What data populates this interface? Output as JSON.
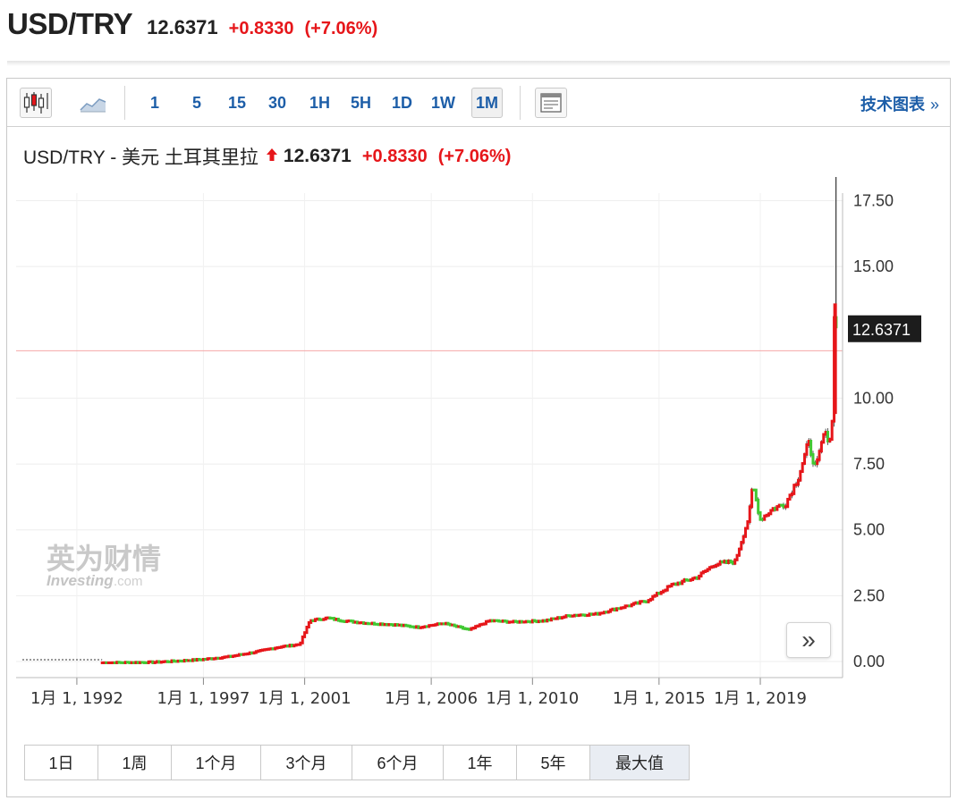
{
  "header": {
    "symbol": "USD/TRY",
    "price": "12.6371",
    "change": "+0.8330",
    "change_pct": "(+7.06%)"
  },
  "toolbar": {
    "icons": [
      "candlestick-icon",
      "area-chart-icon",
      "layout-icon"
    ],
    "intervals": [
      "1",
      "5",
      "15",
      "30",
      "1H",
      "5H",
      "1D",
      "1W",
      "1M"
    ],
    "active_interval": "1M",
    "tech_label": "技术图表",
    "tech_arrow": "»"
  },
  "chart_title": {
    "name": "USD/TRY - 美元 土耳其里拉",
    "price": "12.6371",
    "change": "+0.8330",
    "change_pct": "(+7.06%)"
  },
  "watermark": {
    "cn": "英为财情",
    "en": "Investing",
    "domain": ".com"
  },
  "range_buttons": [
    "1日",
    "1周",
    "1个月",
    "3个月",
    "6个月",
    "1年",
    "5年",
    "最大值"
  ],
  "active_range": "最大值",
  "nav_button": "»",
  "colors": {
    "up": "#e6161a",
    "down": "#41c832",
    "price_line": "#f4a7a7",
    "label_bg": "#1c1c1c"
  },
  "chart_data": {
    "type": "line",
    "title": "USD/TRY - 美元 土耳其里拉",
    "x_ticks": [
      "1月 1, 1992",
      "1月 1, 1997",
      "1月 1, 2001",
      "1月 1, 2006",
      "1月 1, 2010",
      "1月 1, 2015",
      "1月 1, 2019"
    ],
    "y_ticks": [
      "0.00",
      "2.50",
      "5.00",
      "7.50",
      "10.00",
      "12.50",
      "15.00",
      "17.50"
    ],
    "ylim": [
      0,
      18.4
    ],
    "last_price_label": "12.6371",
    "last_price_line": 11.8,
    "series": [
      {
        "x": [
          1991.0,
          1993.0,
          1994.0,
          1995.0,
          1996.0,
          1997.0,
          1998.0,
          1999.0,
          2000.0,
          2000.8,
          2001.2,
          2001.9,
          2002.5,
          2003.5,
          2004.5,
          2005.5,
          2006.5,
          2007.5,
          2008.3,
          2009.2,
          2010.5,
          2011.5,
          2012.5,
          2013.5,
          2014.5,
          2015.5,
          2016.5,
          2017.2,
          2018.0,
          2018.55,
          2018.7,
          2019.0,
          2019.5,
          2020.0,
          2020.5,
          2020.9,
          2021.2,
          2021.5,
          2021.75,
          2021.85,
          2021.92,
          2021.97
        ],
        "values": [
          0.0,
          -0.05,
          -0.04,
          -0.03,
          0.02,
          0.08,
          0.18,
          0.35,
          0.55,
          0.65,
          1.55,
          1.65,
          1.55,
          1.45,
          1.4,
          1.3,
          1.45,
          1.2,
          1.55,
          1.5,
          1.55,
          1.75,
          1.8,
          2.05,
          2.3,
          2.9,
          3.2,
          3.7,
          3.8,
          5.5,
          6.7,
          5.4,
          5.8,
          6.0,
          7.0,
          8.3,
          7.3,
          8.6,
          8.5,
          9.2,
          13.5,
          12.64
        ]
      }
    ],
    "grid": true,
    "legend": "none"
  }
}
